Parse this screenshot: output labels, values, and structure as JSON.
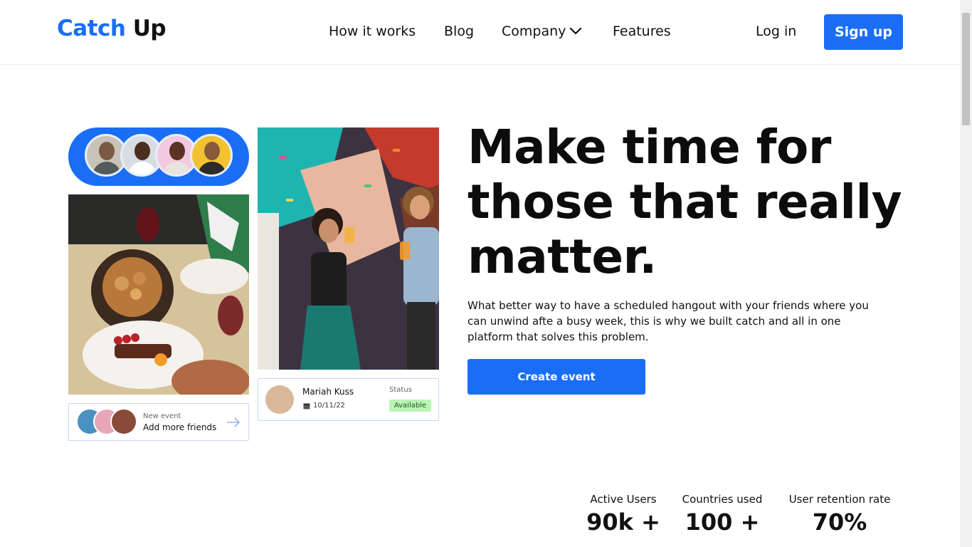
{
  "header": {
    "logo_part1": "Catch",
    "logo_part2": "Up",
    "nav": {
      "how_it_works": "How it works",
      "blog": "Blog",
      "company": "Company",
      "features": "Features"
    },
    "login": "Log in",
    "signup": "Sign up"
  },
  "hero": {
    "title_line1": "Make time for",
    "title_line2": "those that really",
    "title_line3": "matter.",
    "description": "What better way to have a scheduled hangout with your friends where you can unwind afte a busy week, this is why we built catch and all in one platform that solves this problem.",
    "cta": "Create event"
  },
  "cards": {
    "friends": {
      "eyebrow": "New event",
      "title": "Add more friends"
    },
    "status": {
      "name": "Mariah Kuss",
      "date": "10/11/22",
      "status_label": "Status",
      "status_value": "Available"
    }
  },
  "stats": [
    {
      "label": "Active Users",
      "value": "90k +"
    },
    {
      "label": "Countries used",
      "value": "100 +"
    },
    {
      "label": "User retention rate",
      "value": "70%"
    }
  ],
  "colors": {
    "brand": "#1a6ef5",
    "status_available_bg": "#b9f5b6",
    "card_border": "#c9d6f0"
  },
  "icons": {
    "company_dropdown": "chevron-down-icon",
    "add_friends_arrow": "arrow-right-icon",
    "date": "calendar-icon"
  }
}
